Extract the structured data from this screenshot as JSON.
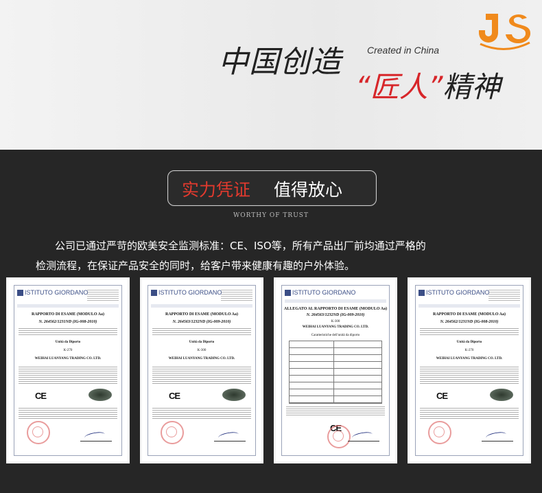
{
  "banner": {
    "brand_logo": "JS",
    "title_cn": "中国创造",
    "created_in": "Created in China",
    "quote_open": "“",
    "jiangren": "匠人",
    "quote_close": "”",
    "jingshen": "精神"
  },
  "trust": {
    "label_red": "实力凭证",
    "label_white": "值得放心",
    "subtitle": "WORTHY OF TRUST"
  },
  "description": {
    "line1": "公司已通过严苛的欧美安全监测标准：CE、ISO等，所有产品出厂前均通过严格的",
    "line2": "检测流程，在保证产品安全的同时，给客户带来健康有趣的户外体验。"
  },
  "certificates": [
    {
      "logo": "ISTITUTO GIORDANO",
      "heading": "RAPPORTO DI ESAME (MODULO Aa)",
      "number": "N. 264562/1231ND (IG-008-2010)",
      "subject": "Unità da Diporto",
      "model": "K-270",
      "company": "WEIHAI LUANYANG TRADING CO. LTD.",
      "mark": "CE"
    },
    {
      "logo": "ISTITUTO GIORDANO",
      "heading": "RAPPORTO DI ESAME (MODULO Aa)",
      "number": "N. 264563/1232ND (IG-009-2010)",
      "subject": "Unità da Diporto",
      "model": "K-300",
      "company": "WEIHAI LUANYANG TRADING CO. LTD.",
      "mark": "CE"
    },
    {
      "logo": "ISTITUTO GIORDANO",
      "heading": "ALLEGATO AL RAPPORTO DI ESAME (MODULO Aa)",
      "number": "N. 264563/1232ND (IG-009-2010)",
      "subject": "Caratteristiche dell'unità da diporto",
      "model": "K-300",
      "company": "WEIHAI LUANYANG TRADING CO. LTD.",
      "mark": "CE"
    },
    {
      "logo": "ISTITUTO GIORDANO",
      "heading": "RAPPORTO DI ESAME (MODULO Aa)",
      "number": "N. 264562/1231ND (IG-008-2010)",
      "subject": "Unità da Diporto",
      "model": "K-270",
      "company": "WEIHAI LUANYANG TRADING CO. LTD.",
      "mark": "CE"
    }
  ]
}
